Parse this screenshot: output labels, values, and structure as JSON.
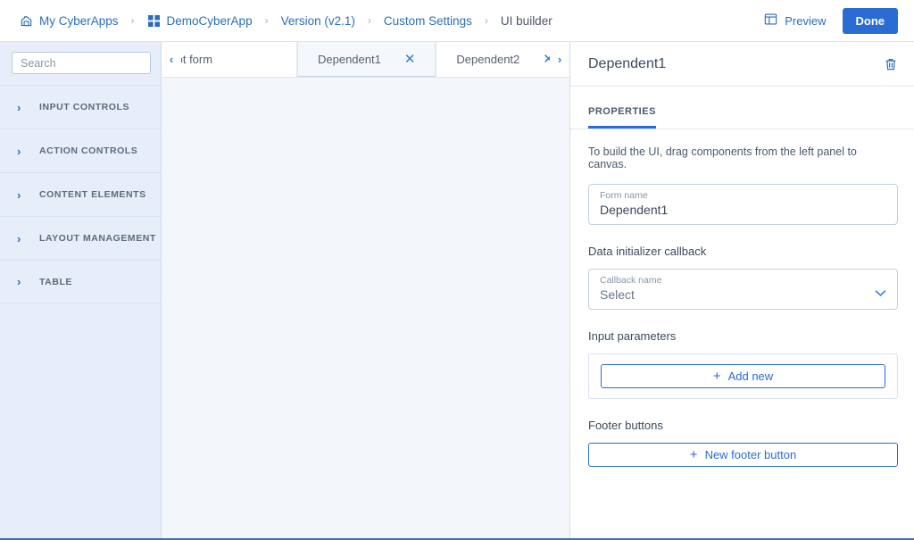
{
  "breadcrumb": {
    "items": [
      {
        "label": "My CyberApps",
        "icon": "home-building-icon",
        "current": false
      },
      {
        "label": "DemoCyberApp",
        "icon": "grid-apps-icon",
        "current": false
      },
      {
        "label": "Version (v2.1)",
        "icon": "",
        "current": false
      },
      {
        "label": "Custom Settings",
        "icon": "",
        "current": false
      },
      {
        "label": "UI builder",
        "icon": "",
        "current": true
      }
    ],
    "separator": "›"
  },
  "sidebar": {
    "search": {
      "placeholder": "Search",
      "value": "",
      "icon": "search-icon"
    },
    "categories": [
      {
        "label": "INPUT CONTROLS",
        "chevron": "›"
      },
      {
        "label": "ACTION CONTROLS",
        "chevron": "›"
      },
      {
        "label": "CONTENT ELEMENTS",
        "chevron": "›"
      },
      {
        "label": "LAYOUT MANAGEMENT",
        "chevron": "›"
      },
      {
        "label": "TABLE",
        "chevron": "›"
      }
    ]
  },
  "tabbar": {
    "scroll_left": "‹",
    "scroll_right": "›",
    "tabs": [
      {
        "label": "Root form",
        "closable": false,
        "active": false
      },
      {
        "label": "Dependent1",
        "closable": true,
        "active": true,
        "close": "✕"
      },
      {
        "label": "Dependent2",
        "closable": true,
        "active": false,
        "close": "✕"
      }
    ]
  },
  "toolbar": {
    "preview_label": "Preview",
    "preview_icon": "preview-layout-icon",
    "done_label": "Done"
  },
  "panel": {
    "title": "Dependent1",
    "delete_icon": "trash-icon",
    "tabs": [
      {
        "label": "PROPERTIES",
        "active": true
      }
    ],
    "hint": "To build the UI, drag components from the left panel to canvas.",
    "form_name": {
      "label": "Form name",
      "value": "Dependent1"
    },
    "data_initializer": {
      "section_label": "Data initializer callback",
      "field_label": "Callback name",
      "value": "Select",
      "chevron": "⌄"
    },
    "input_parameters": {
      "section_label": "Input parameters",
      "add_label": "Add new",
      "add_plus": "+"
    },
    "footer_buttons": {
      "section_label": "Footer buttons",
      "add_label": "New footer button",
      "add_plus": "+"
    }
  },
  "colors": {
    "accent": "#2b6cd4",
    "link": "#2a6ebb",
    "sidebar_bg": "#e7eefa",
    "canvas_bg": "#f3f6fb",
    "page_border": "#3f6fb5"
  }
}
